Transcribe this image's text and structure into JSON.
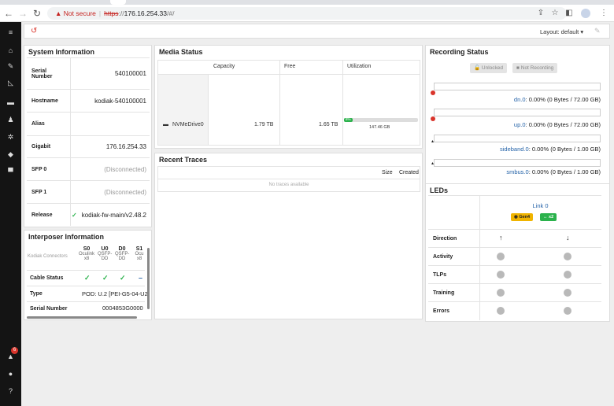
{
  "browser": {
    "warning_icon": "warning-triangle-icon",
    "not_secure": "Not secure",
    "url_scheme": "https",
    "url_sep": "://",
    "url_host": "176.16.254.33",
    "url_path": "/#/"
  },
  "topbar": {
    "layout_label": "Layout: default"
  },
  "sidebar": {
    "notifications_badge": "6"
  },
  "system_info": {
    "title": "System Information",
    "rows": [
      {
        "key": "Serial Number",
        "value": "540100001"
      },
      {
        "key": "Hostname",
        "value": "kodiak-540100001"
      },
      {
        "key": "Alias",
        "value": ""
      },
      {
        "key": "Gigabit",
        "value": "176.16.254.33"
      },
      {
        "key": "SFP 0",
        "value": "(Disconnected)"
      },
      {
        "key": "SFP 1",
        "value": "(Disconnected)"
      },
      {
        "key": "Release",
        "value": "kodiak-fw-main/v2.48.2"
      }
    ]
  },
  "interposer": {
    "title": "Interposer Information",
    "connectors_label": "Kodiak Connectors",
    "columns": [
      {
        "id": "S0",
        "sub1": "Oculink",
        "sub2": "x8"
      },
      {
        "id": "U0",
        "sub1": "QSFP-",
        "sub2": "DD"
      },
      {
        "id": "D0",
        "sub1": "QSFP-",
        "sub2": "DD"
      },
      {
        "id": "S1",
        "sub1": "Ocu",
        "sub2": "x8"
      }
    ],
    "cable_status_label": "Cable Status",
    "type_label": "Type",
    "type_value": "POD: U.2 [PEI-G5-04-U2",
    "serial_label": "Serial Number",
    "serial_value": "0004853G0000"
  },
  "media": {
    "title": "Media Status",
    "headers": [
      "Capacity",
      "Free",
      "Utilization"
    ],
    "drive": {
      "name": "NVMeDrive0",
      "capacity": "1.79 TB",
      "free": "1.65 TB",
      "util_label": "8%",
      "util_fraction": 0.08,
      "util_size": "147.46 GB"
    }
  },
  "traces": {
    "title": "Recent Traces",
    "headers": [
      "Size",
      "Created"
    ],
    "empty": "No traces available"
  },
  "recording": {
    "title": "Recording Status",
    "unlocked_label": "Unlocked",
    "not_recording_label": "Not Recording",
    "channels": [
      {
        "name": "dn.0",
        "value": ": 0.00% (0 Bytes / 72.00 GB)"
      },
      {
        "name": "up.0",
        "value": ": 0.00% (0 Bytes / 72.00 GB)"
      },
      {
        "name": "sideband.0",
        "value": ": 0.00% (0 Bytes / 1.00 GB)"
      },
      {
        "name": "smbus.0",
        "value": ": 0.00% (0 Bytes / 1.00 GB)"
      }
    ]
  },
  "leds": {
    "title": "LEDs",
    "link_label": "Link 0",
    "gen_badge": "Gen4",
    "width_badge": "x2",
    "rows": [
      "Direction",
      "Activity",
      "TLPs",
      "Training",
      "Errors"
    ],
    "status_color": "#b9b9b9",
    "accent_green": "#2bb24c",
    "accent_yellow": "#f0b400"
  }
}
